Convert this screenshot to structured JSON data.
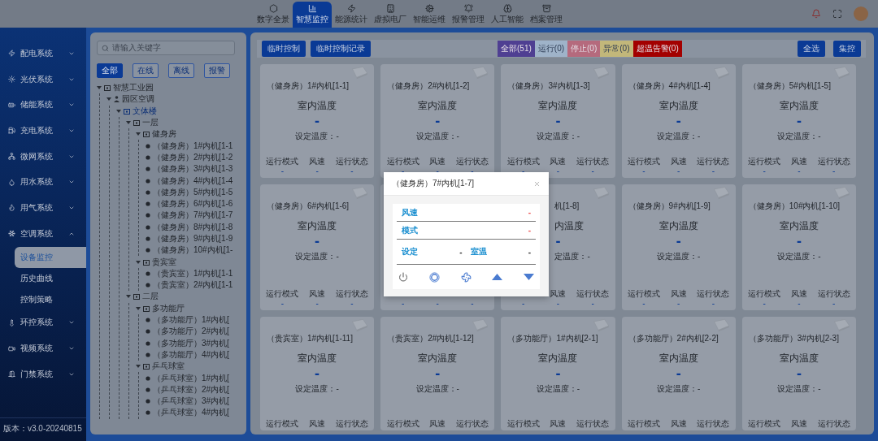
{
  "top_nav": {
    "items": [
      {
        "label": "数字全景",
        "selected": false
      },
      {
        "label": "智慧监控",
        "selected": true
      },
      {
        "label": "能源统计",
        "selected": false
      },
      {
        "label": "虚拟电厂",
        "selected": false
      },
      {
        "label": "智能运维",
        "selected": false
      },
      {
        "label": "报警管理",
        "selected": false
      },
      {
        "label": "人工智能",
        "selected": false
      },
      {
        "label": "档案管理",
        "selected": false
      }
    ]
  },
  "sidebar": {
    "items": [
      {
        "label": "配电系统",
        "expanded": false
      },
      {
        "label": "光伏系统",
        "expanded": false
      },
      {
        "label": "储能系统",
        "expanded": false
      },
      {
        "label": "充电系统",
        "expanded": false
      },
      {
        "label": "微网系统",
        "expanded": false
      },
      {
        "label": "用水系统",
        "expanded": false
      },
      {
        "label": "用气系统",
        "expanded": false
      },
      {
        "label": "空调系统",
        "expanded": true,
        "children": [
          {
            "label": "设备监控",
            "selected": true
          },
          {
            "label": "历史曲线",
            "selected": false
          },
          {
            "label": "控制策略",
            "selected": false
          }
        ]
      },
      {
        "label": "环控系统",
        "expanded": false
      },
      {
        "label": "视频系统",
        "expanded": false
      },
      {
        "label": "门禁系统",
        "expanded": false
      }
    ],
    "version": "版本：v3.0-20240815"
  },
  "tree_panel": {
    "search": {
      "placeholder": "请输入关键字"
    },
    "filters": [
      {
        "label": "全部",
        "selected": true
      },
      {
        "label": "在线",
        "selected": false
      },
      {
        "label": "离线",
        "selected": false
      },
      {
        "label": "报警",
        "selected": false
      }
    ],
    "tree": [
      {
        "label": "智慧工业园",
        "kind": "building",
        "expanded": true,
        "selected": false,
        "children": [
          {
            "label": "园区空调",
            "kind": "system",
            "expanded": true,
            "selected": false,
            "children": [
              {
                "label": "文体楼",
                "kind": "building",
                "expanded": true,
                "selected": true,
                "children": [
                  {
                    "label": "一层",
                    "kind": "building",
                    "expanded": true,
                    "selected": false,
                    "children": [
                      {
                        "label": "健身房",
                        "kind": "building",
                        "expanded": true,
                        "selected": false,
                        "children": [
                          {
                            "label": "（健身房）1#内机[1-1",
                            "kind": "device",
                            "selected": false
                          },
                          {
                            "label": "（健身房）2#内机[1-2",
                            "kind": "device",
                            "selected": false
                          },
                          {
                            "label": "（健身房）3#内机[1-3",
                            "kind": "device",
                            "selected": false
                          },
                          {
                            "label": "（健身房）4#内机[1-4",
                            "kind": "device",
                            "selected": false
                          },
                          {
                            "label": "（健身房）5#内机[1-5",
                            "kind": "device",
                            "selected": false
                          },
                          {
                            "label": "（健身房）6#内机[1-6",
                            "kind": "device",
                            "selected": false
                          },
                          {
                            "label": "（健身房）7#内机[1-7",
                            "kind": "device",
                            "selected": false
                          },
                          {
                            "label": "（健身房）8#内机[1-8",
                            "kind": "device",
                            "selected": false
                          },
                          {
                            "label": "（健身房）9#内机[1-9",
                            "kind": "device",
                            "selected": false
                          },
                          {
                            "label": "（健身房）10#内机[1-",
                            "kind": "device",
                            "selected": false
                          }
                        ]
                      },
                      {
                        "label": "贵宾室",
                        "kind": "building",
                        "expanded": true,
                        "selected": false,
                        "children": [
                          {
                            "label": "（贵宾室）1#内机[1-1",
                            "kind": "device",
                            "selected": false
                          },
                          {
                            "label": "（贵宾室）2#内机[1-1",
                            "kind": "device",
                            "selected": false
                          }
                        ]
                      }
                    ]
                  },
                  {
                    "label": "二层",
                    "kind": "building",
                    "expanded": true,
                    "selected": false,
                    "children": [
                      {
                        "label": "多功能厅",
                        "kind": "building",
                        "expanded": true,
                        "selected": false,
                        "children": [
                          {
                            "label": "（多功能厅）1#内机[",
                            "kind": "device",
                            "selected": false
                          },
                          {
                            "label": "（多功能厅）2#内机[",
                            "kind": "device",
                            "selected": false
                          },
                          {
                            "label": "（多功能厅）3#内机[",
                            "kind": "device",
                            "selected": false
                          },
                          {
                            "label": "（多功能厅）4#内机[",
                            "kind": "device",
                            "selected": false
                          }
                        ]
                      },
                      {
                        "label": "乒乓球室",
                        "kind": "building",
                        "expanded": true,
                        "selected": false,
                        "children": [
                          {
                            "label": "（乒乓球室）1#内机[",
                            "kind": "device",
                            "selected": false
                          },
                          {
                            "label": "（乒乓球室）2#内机[",
                            "kind": "device",
                            "selected": false
                          },
                          {
                            "label": "（乒乓球室）3#内机[",
                            "kind": "device",
                            "selected": false
                          },
                          {
                            "label": "（乒乓球室）4#内机[",
                            "kind": "device",
                            "selected": false
                          }
                        ]
                      }
                    ]
                  }
                ]
              }
            ]
          }
        ]
      }
    ]
  },
  "toolbar": {
    "left_buttons": [
      "临时控制",
      "临时控制记录"
    ],
    "status_filters": [
      {
        "label": "全部(51)",
        "color": "#4f3f92"
      },
      {
        "label": "运行(0)",
        "color": "#9fb3c9"
      },
      {
        "label": "停止(0)",
        "color": "#b56a7d"
      },
      {
        "label": "异常(0)",
        "color": "#c2b77a"
      },
      {
        "label": "超温告警(0)",
        "color": "#a30000"
      }
    ],
    "right_buttons": [
      "全选",
      "集控"
    ]
  },
  "cards": [
    {
      "kind": "full",
      "title": "（健身房）1#内机[1-1]",
      "temp_label": "室内温度",
      "temp_value": "-",
      "set_temp": "设定温度：-",
      "stats": [
        {
          "label": "运行模式",
          "value": "-"
        },
        {
          "label": "风速",
          "value": "-"
        },
        {
          "label": "运行状态",
          "value": "-"
        }
      ]
    },
    {
      "kind": "full",
      "title": "（健身房）2#内机[1-2]",
      "temp_label": "室内温度",
      "temp_value": "-",
      "set_temp": "设定温度：-",
      "stats": [
        {
          "label": "运行模式",
          "value": "-"
        },
        {
          "label": "风速",
          "value": "-"
        },
        {
          "label": "运行状态",
          "value": "-"
        }
      ]
    },
    {
      "kind": "full",
      "title": "（健身房）3#内机[1-3]",
      "temp_label": "室内温度",
      "temp_value": "-",
      "set_temp": "设定温度：-",
      "stats": [
        {
          "label": "运行模式",
          "value": "-"
        },
        {
          "label": "风速",
          "value": "-"
        },
        {
          "label": "运行状态",
          "value": "-"
        }
      ]
    },
    {
      "kind": "full",
      "title": "（健身房）4#内机[1-4]",
      "temp_label": "室内温度",
      "temp_value": "-",
      "set_temp": "设定温度：-",
      "stats": [
        {
          "label": "运行模式",
          "value": "-"
        },
        {
          "label": "风速",
          "value": "-"
        },
        {
          "label": "运行状态",
          "value": "-"
        }
      ]
    },
    {
      "kind": "full",
      "title": "（健身房）5#内机[1-5]",
      "temp_label": "室内温度",
      "temp_value": "-",
      "set_temp": "设定温度：-",
      "stats": [
        {
          "label": "运行模式",
          "value": "-"
        },
        {
          "label": "风速",
          "value": "-"
        },
        {
          "label": "运行状态",
          "value": "-"
        }
      ]
    },
    {
      "kind": "full",
      "title": "（健身房）6#内机[1-6]",
      "temp_label": "室内温度",
      "temp_value": "-",
      "set_temp": "设定温度：-",
      "stats": [
        {
          "label": "运行模式",
          "value": "-"
        },
        {
          "label": "风速",
          "value": "-"
        },
        {
          "label": "运行状态",
          "value": "-"
        }
      ]
    },
    {
      "kind": "covered",
      "stats": [
        {
          "value": "-"
        },
        {
          "value": "-"
        },
        {
          "value": "-"
        }
      ]
    },
    {
      "kind": "partial",
      "title": "机[1-8]",
      "temp_label": "内温度",
      "temp_value": "-",
      "set_temp": "定温度：-",
      "stats": [
        {
          "value": "-"
        },
        {
          "label": "风速",
          "value": "-"
        },
        {
          "label": "运行状态",
          "value": "-"
        }
      ]
    },
    {
      "kind": "full",
      "title": "（健身房）9#内机[1-9]",
      "temp_label": "室内温度",
      "temp_value": "-",
      "set_temp": "设定温度：-",
      "stats": [
        {
          "label": "运行模式",
          "value": "-"
        },
        {
          "label": "风速",
          "value": "-"
        },
        {
          "label": "运行状态",
          "value": "-"
        }
      ]
    },
    {
      "kind": "full",
      "title": "（健身房）10#内机[1-10]",
      "temp_label": "室内温度",
      "temp_value": "-",
      "set_temp": "设定温度：-",
      "stats": [
        {
          "label": "运行模式",
          "value": "-"
        },
        {
          "label": "风速",
          "value": "-"
        },
        {
          "label": "运行状态",
          "value": "-"
        }
      ]
    },
    {
      "kind": "full",
      "title": "（贵宾室）1#内机[1-11]",
      "temp_label": "室内温度",
      "temp_value": "-",
      "set_temp": "设定温度：-",
      "stats": [
        {
          "label": "运行模式"
        },
        {
          "label": "风速"
        },
        {
          "label": "运行状态"
        }
      ]
    },
    {
      "kind": "full",
      "title": "（贵宾室）2#内机[1-12]",
      "temp_label": "室内温度",
      "temp_value": "-",
      "set_temp": "设定温度：-",
      "stats": [
        {
          "label": "运行模式"
        },
        {
          "label": "风速"
        },
        {
          "label": "运行状态"
        }
      ]
    },
    {
      "kind": "full",
      "title": "（多功能厅）1#内机[2-1]",
      "temp_label": "室内温度",
      "temp_value": "-",
      "set_temp": "设定温度：-",
      "stats": [
        {
          "label": "运行模式"
        },
        {
          "label": "风速"
        },
        {
          "label": "运行状态"
        }
      ]
    },
    {
      "kind": "full",
      "title": "（多功能厅）2#内机[2-2]",
      "temp_label": "室内温度",
      "temp_value": "-",
      "set_temp": "设定温度：-",
      "stats": [
        {
          "label": "运行模式"
        },
        {
          "label": "风速"
        },
        {
          "label": "运行状态"
        }
      ]
    },
    {
      "kind": "full",
      "title": "（多功能厅）3#内机[2-3]",
      "temp_label": "室内温度",
      "temp_value": "-",
      "set_temp": "设定温度：-",
      "stats": [
        {
          "label": "运行模式"
        },
        {
          "label": "风速"
        },
        {
          "label": "运行状态"
        }
      ]
    }
  ],
  "dialog": {
    "title": "（健身房）7#内机[1-7]",
    "rows": [
      {
        "label": "风速",
        "value": "-"
      },
      {
        "label": "模式",
        "value": "-"
      }
    ],
    "setpoint": {
      "label": "设定",
      "value": "-"
    },
    "room_temp": {
      "label": "室温",
      "value": "-"
    }
  }
}
